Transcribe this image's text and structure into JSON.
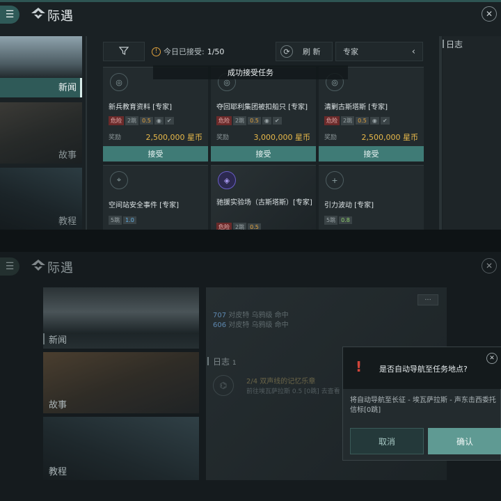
{
  "app": {
    "title": "际遇"
  },
  "top": {
    "sidebar": [
      {
        "label": "新闻"
      },
      {
        "label": "故事"
      },
      {
        "label": "教程"
      }
    ],
    "filter": {
      "daily_label": "今日已接受:",
      "daily_count": "1/50",
      "refresh_label": "刷 新",
      "difficulty": "专家"
    },
    "toast": "成功接受任务",
    "log_title": "日志",
    "reward_label": "奖励",
    "accept_label": "接受",
    "cards": [
      {
        "title": "新兵教育资料 [专家]",
        "tags": [
          "危险",
          "2跳",
          "0.5"
        ],
        "reward": "2,500,000 星币"
      },
      {
        "title": "夺回耶利集团被扣船只 [专家]",
        "tags": [
          "危险",
          "2跳",
          "0.5"
        ],
        "reward": "3,000,000 星币"
      },
      {
        "title": "清剿古斯塔斯 [专家]",
        "tags": [
          "危险",
          "2跳",
          "0.5"
        ],
        "reward": "2,500,000 星币"
      },
      {
        "title": "空间站安全事件 [专家]",
        "tags": [
          "5跳",
          "1.0"
        ]
      },
      {
        "title": "驰援实验场（古斯塔斯）[专家]",
        "tags": [
          "危险",
          "2跳",
          "0.5"
        ]
      },
      {
        "title": "引力波动 [专家]",
        "tags": [
          "5跳",
          "0.8"
        ]
      }
    ]
  },
  "bottom": {
    "sidebar": [
      {
        "label": "新闻"
      },
      {
        "label": "故事"
      },
      {
        "label": "教程"
      }
    ],
    "feed": [
      {
        "code": "707",
        "text": "对皮特 乌鸦级 命中"
      },
      {
        "code": "606",
        "text": "对皮特 乌鸦级 命中"
      }
    ],
    "log_title": "日志",
    "log_count": "1",
    "log_entry": {
      "progress": "2/4",
      "title": "双声线的记忆乐章",
      "detail": "前往埃瓦萨拉斯 0.5 [0跳] 去查看"
    },
    "more": "···",
    "dialog": {
      "title": "是否自动导航至任务地点?",
      "body": "将自动导航至长征 - 埃瓦萨拉斯 - 声东击西委托信标[0跳]",
      "cancel": "取消",
      "confirm": "确认"
    }
  },
  "colors": {
    "accent": "#3f7b76",
    "reward": "#e8b94a",
    "danger": "#6b2a2a"
  }
}
